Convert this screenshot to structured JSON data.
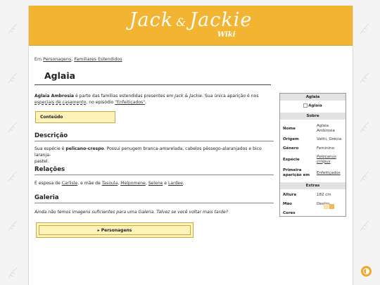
{
  "logo": {
    "part1": "Jack",
    "amp": "&",
    "part2": "Jackie",
    "sub": "Wiki"
  },
  "breadcrumb": {
    "prefix": "Em ",
    "link1": "Personagens",
    "sep": ", ",
    "link2": "Familiares Estendidos"
  },
  "page_title": "Aglaia",
  "intro": {
    "name_bold": "Aglaia Ambrosia",
    "text1": " é parte das famílias estendidas presentes em ",
    "show_italic": "Jack & Jackie",
    "text2": ". Sua única aparição é nos ",
    "link_special": "especiais de casamento",
    "text3": ", no episódio ",
    "link_episode": "\"Enfeitiçados\"",
    "text4": "."
  },
  "toc_label": "Conteúdo",
  "sections": {
    "descricao": {
      "heading": "Descrição",
      "text1": "Sua espécie é ",
      "bold": "pelicano-crespo",
      "text2": ". Possui penugem branca-amarelada, cabelos pêssego-alaranjados e bico laranja-",
      "text3": "pastel."
    },
    "relacoes": {
      "heading": "Relações",
      "text1": "É esposa de ",
      "link1": "Carlisle",
      "text2": ", e mãe de ",
      "link2": "Tasoula",
      "sep1": ", ",
      "link3": "Melpomene",
      "sep2": ", ",
      "link4": "Selene",
      "text3": " e ",
      "link5": "Lardee",
      "text4": "."
    },
    "galeria": {
      "heading": "Galeria",
      "text": "Ainda não temos imagens suficientes para uma Galeria. Talvez se você voltar mais tarde?"
    }
  },
  "navbox_label": "▸ Personagens",
  "infobox": {
    "title": "Aglaia",
    "image_alt": "Aglaia",
    "sobre": "Sobre",
    "rows": [
      {
        "label": "Nome",
        "value": "Aglaia Ambrosia"
      },
      {
        "label": "Origem",
        "value": "Vathi, Grécia"
      },
      {
        "label": "Gênero",
        "value": "Feminino"
      },
      {
        "label": "Espécie",
        "value": "Pelecanus crispus"
      },
      {
        "label": "Primeira aparição em",
        "value": "Enfeitiçados"
      }
    ],
    "extras": "Extras",
    "extra_rows": [
      {
        "label": "Altura",
        "value": "182 cm"
      },
      {
        "label": "Mão",
        "value": "Destro"
      },
      {
        "label": "Cores",
        "value": ""
      }
    ],
    "colors": [
      "#fbe0a8",
      "#f6b45a"
    ]
  },
  "theme": {
    "accent": "#f2b431",
    "highlight": "#fdf3b8"
  }
}
